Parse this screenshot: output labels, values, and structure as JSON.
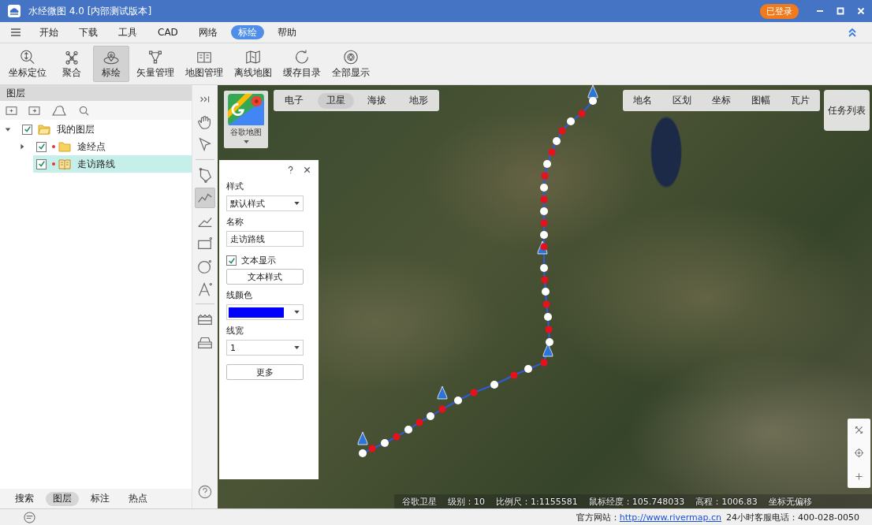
{
  "window": {
    "title": "水经微图 4.0 [内部测试版本]",
    "login_button": "已登录"
  },
  "menu": [
    {
      "label": "开始",
      "selected": false
    },
    {
      "label": "下载",
      "selected": false
    },
    {
      "label": "工具",
      "selected": false
    },
    {
      "label": "CAD",
      "selected": false
    },
    {
      "label": "网络",
      "selected": false
    },
    {
      "label": "标绘",
      "selected": true
    },
    {
      "label": "帮助",
      "selected": false
    }
  ],
  "toolbar": [
    {
      "kind": "locate",
      "label": "坐标定位",
      "selected": false
    },
    {
      "kind": "cluster",
      "label": "聚合",
      "selected": false
    },
    {
      "kind": "plot",
      "label": "标绘",
      "selected": true
    },
    {
      "kind": "vector",
      "label": "矢量管理",
      "selected": false
    },
    {
      "kind": "map-edit",
      "label": "地图管理",
      "selected": false
    },
    {
      "kind": "offline-map",
      "label": "离线地图",
      "selected": false
    },
    {
      "kind": "cache",
      "label": "缓存目录",
      "selected": false
    },
    {
      "kind": "display",
      "label": "全部显示",
      "selected": false
    }
  ],
  "layer_panel": {
    "title": "图层",
    "tree": [
      {
        "kind": "folder",
        "label": "我的图层",
        "checked": true,
        "expanded": true,
        "selected": false,
        "children": [
          {
            "kind": "folder",
            "label": "途经点",
            "checked": true,
            "expanded": false,
            "selected": false
          },
          {
            "kind": "route",
            "label": "走访路线",
            "checked": true,
            "selected": true
          }
        ]
      }
    ],
    "tabs": [
      {
        "label": "搜索",
        "selected": false
      },
      {
        "label": "图层",
        "selected": true
      },
      {
        "label": "标注",
        "selected": false
      },
      {
        "label": "热点",
        "selected": false
      }
    ]
  },
  "draw_tools": [
    {
      "kind": "collapse",
      "selected": false
    },
    {
      "kind": "hand",
      "selected": false
    },
    {
      "kind": "pointer",
      "selected": false
    },
    {
      "kind": "separator"
    },
    {
      "kind": "polygon",
      "selected": false
    },
    {
      "kind": "polyline",
      "selected": true
    },
    {
      "kind": "angle",
      "selected": false
    },
    {
      "kind": "rectangle",
      "selected": false
    },
    {
      "kind": "circle",
      "selected": false
    },
    {
      "kind": "text",
      "selected": false
    },
    {
      "kind": "separator"
    },
    {
      "kind": "ruler",
      "selected": false
    },
    {
      "kind": "case",
      "selected": false
    }
  ],
  "map": {
    "source_label": "谷歌地图",
    "map_types": [
      {
        "label": "电子",
        "selected": false
      },
      {
        "label": "卫星",
        "selected": true
      },
      {
        "label": "海拔",
        "selected": false
      },
      {
        "label": "地形",
        "selected": false
      }
    ],
    "overlays": [
      "地名",
      "区划",
      "坐标",
      "图幅",
      "瓦片"
    ],
    "task_button": "任务列表",
    "status": [
      "谷歌卫星",
      "级别：10",
      "比例尺：1:1155581",
      "鼠标经度：105.748033",
      "高程：1006.83",
      "坐标无偏移"
    ]
  },
  "style_panel": {
    "fields": [
      {
        "kind": "select",
        "label": "样式",
        "value": "默认样式"
      },
      {
        "kind": "text",
        "label": "名称",
        "value": "走访路线"
      },
      {
        "kind": "checkbox",
        "label": "文本显示",
        "checked": true
      },
      {
        "kind": "button",
        "label": "文本样式"
      },
      {
        "kind": "color",
        "label": "线颜色",
        "color": "#0000ff"
      },
      {
        "kind": "select",
        "label": "线宽",
        "value": "1"
      },
      {
        "kind": "button",
        "label": "更多"
      }
    ]
  },
  "status_bar": {
    "site_label": "官方网站：",
    "site_link": "http://www.rivermap.cn",
    "hotline": "24小时客服电话：400-028-0050"
  }
}
